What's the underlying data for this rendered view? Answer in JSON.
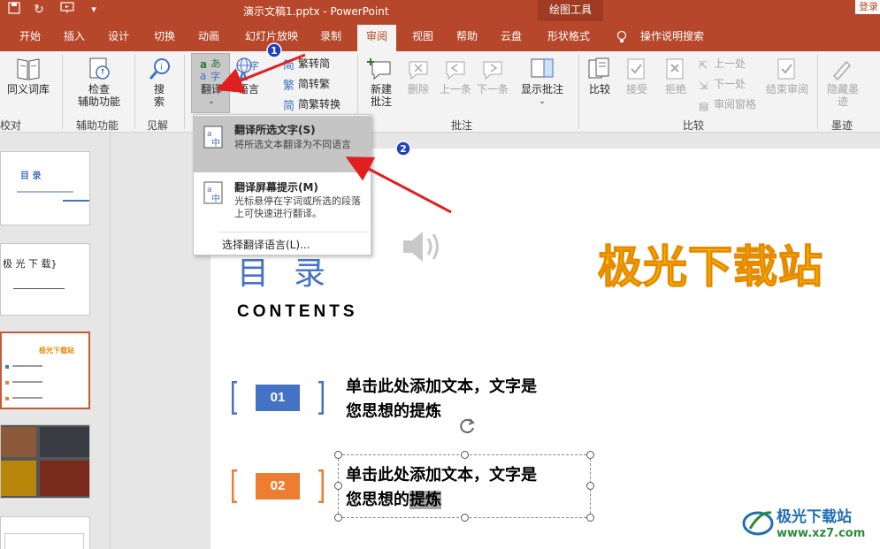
{
  "window": {
    "title": "演示文稿1.pptx  -  PowerPoint",
    "context_group": "绘图工具",
    "login": "登录"
  },
  "tabs": [
    {
      "label": "开始"
    },
    {
      "label": "插入"
    },
    {
      "label": "设计"
    },
    {
      "label": "切换"
    },
    {
      "label": "动画"
    },
    {
      "label": "幻灯片放映"
    },
    {
      "label": "录制"
    },
    {
      "label": "审阅"
    },
    {
      "label": "视图"
    },
    {
      "label": "帮助"
    },
    {
      "label": "云盘"
    },
    {
      "label": "形状格式"
    },
    {
      "label": "操作说明搜索"
    }
  ],
  "active_tab": "审阅",
  "ribbon": {
    "thesaurus": "同义词库",
    "proofing_label": "校对",
    "check_accessibility": "检查\n辅助功能",
    "accessibility_label": "辅助功能",
    "search": "搜\n索",
    "insights_label": "见解",
    "translate": "翻译",
    "language": "语言",
    "trad_to_simp": "繁转简",
    "simp_to_trad": "简转繁",
    "convert": "简繁转换",
    "new_comment": "新建\n批注",
    "delete": "删除",
    "previous": "上一条",
    "next": "下一条",
    "show_comments": "显示批注",
    "comments_label": "批注",
    "compare": "比较",
    "accept": "接受",
    "reject": "拒绝",
    "prev_change": "上一处",
    "next_change": "下一处",
    "review_pane": "审阅窗格",
    "end_review": "结束审阅",
    "compare_label": "比较",
    "hide_ink": "隐藏墨\n迹",
    "ink_label": "墨迹"
  },
  "translate_menu": {
    "item1_title": "翻译所选文字(S)",
    "item1_desc": "将所选文本翻译为不同语言",
    "item2_title": "翻译屏幕提示(M)",
    "item2_desc": "光标悬停在字词或所选的段落上可快速进行翻译。",
    "choose_language": "选择翻译语言(L)..."
  },
  "thumbnails": {
    "t1_title": "目  录",
    "t2_text": "极 光 下 载}",
    "t3_title": "极光下载站"
  },
  "slide": {
    "title": "目录",
    "subtitle": "CONTENTS",
    "brand": "极光下载站",
    "items": [
      {
        "num": "01",
        "text_a": "单击此处添加文本，文字是",
        "text_b": "您思想的提炼"
      },
      {
        "num": "02",
        "text_a": "单击此处添加文本，文字是",
        "text_b_pre": "您思想的",
        "text_b_hl": "提炼"
      }
    ]
  },
  "markers": {
    "m1": "1",
    "m2": "2"
  },
  "watermark": {
    "title": "极光下载站",
    "url": "www.xz7.com"
  },
  "colors": {
    "accent": "#b7472a",
    "blue": "#4472c4",
    "orange": "#ed7d31",
    "brand_yellow": "#ffd700",
    "arrow_red": "#e02020"
  }
}
